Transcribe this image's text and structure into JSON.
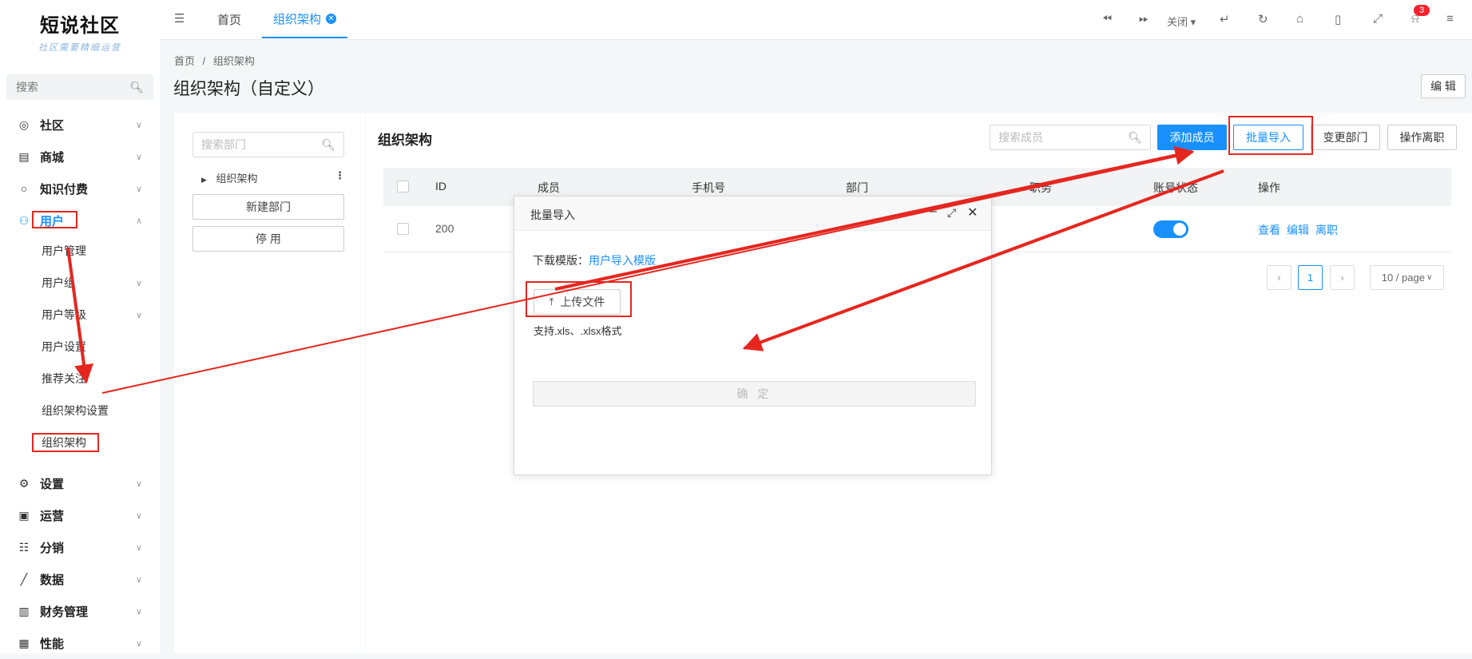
{
  "sidebar": {
    "logo_title": "短说社区",
    "logo_subtitle": "社区需要精细运营",
    "search_placeholder": "搜索",
    "groups": [
      {
        "label": "社区",
        "icon": "chat-icon"
      },
      {
        "label": "商城",
        "icon": "shop-icon"
      },
      {
        "label": "知识付费",
        "icon": "bulb-icon"
      },
      {
        "label": "用户",
        "icon": "user-icon"
      }
    ],
    "user_sub_items": [
      "用户管理",
      "用户组",
      "用户等级",
      "用户设置",
      "推荐关注",
      "组织架构设置",
      "组织架构"
    ],
    "groups_bottom": [
      {
        "label": "设置",
        "icon": "gear-icon"
      },
      {
        "label": "运营",
        "icon": "monitor-icon"
      },
      {
        "label": "分销",
        "icon": "network-icon"
      },
      {
        "label": "数据",
        "icon": "chart-icon"
      },
      {
        "label": "财务管理",
        "icon": "finance-icon"
      },
      {
        "label": "性能",
        "icon": "performance-icon"
      }
    ]
  },
  "topbar": {
    "tabs": [
      {
        "label": "首页"
      },
      {
        "label": "组织架构"
      }
    ],
    "close_label": "关闭",
    "notification_count": "3"
  },
  "breadcrumb": {
    "home": "首页",
    "separator": "/",
    "current": "组织架构"
  },
  "page_title": "组织架构（自定义）",
  "edit_button": "编 辑",
  "dept_panel": {
    "search_placeholder": "搜索部门",
    "tree_root": "组织架构",
    "new_dept_button": "新建部门",
    "disable_button": "停 用"
  },
  "main": {
    "title": "组织架构",
    "member_search_placeholder": "搜索成员",
    "buttons": {
      "add_member": "添加成员",
      "batch_import": "批量导入",
      "change_dept": "变更部门",
      "resign": "操作离职"
    },
    "columns": [
      "ID",
      "成员",
      "手机号",
      "部门",
      "职务",
      "账号状态",
      "操作"
    ],
    "rows": [
      {
        "id": "200",
        "actions": [
          "查看",
          "编辑",
          "离职"
        ],
        "active": true
      }
    ],
    "pagination": {
      "current": "1",
      "page_size": "10 / page"
    }
  },
  "modal": {
    "title": "批量导入",
    "template_label": "下载模版：",
    "template_link": "用户导入模版",
    "upload_button": "上传文件",
    "support_text": "支持.xls、.xlsx格式",
    "confirm_button": "确 定"
  },
  "colors": {
    "accent": "#1890ff",
    "annotation": "#e5261f"
  }
}
